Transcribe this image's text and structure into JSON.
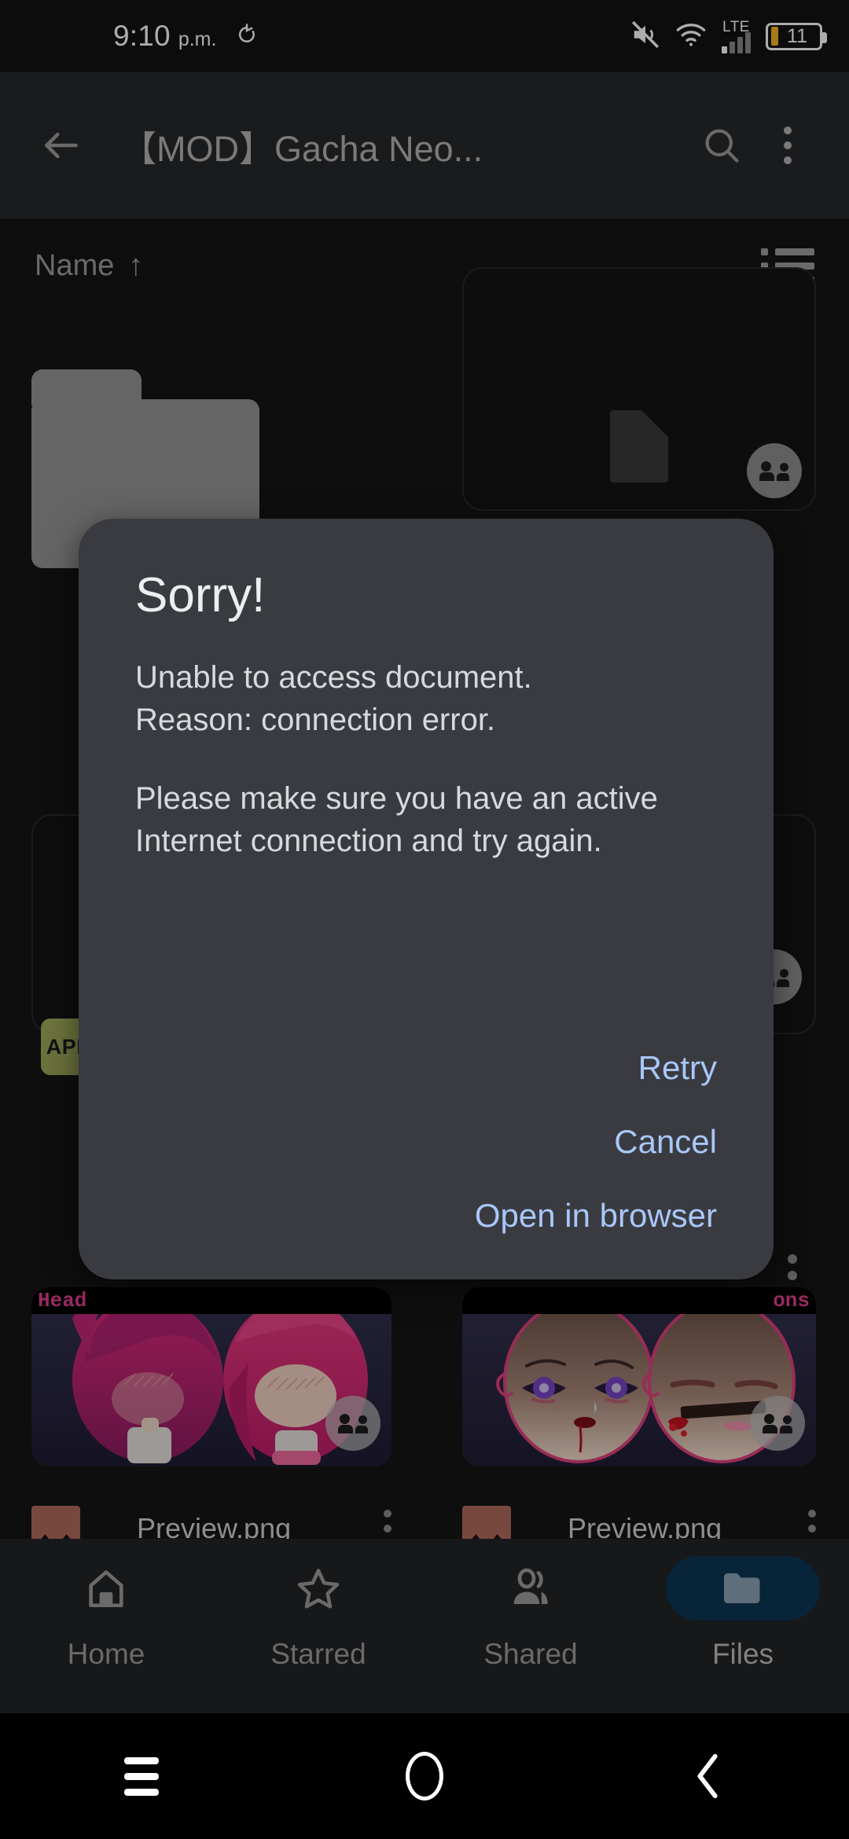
{
  "status_bar": {
    "time": "9:10",
    "ampm": "p.m.",
    "alarm_icon": "alarm-reset-icon",
    "volume_icon": "volume-muted-icon",
    "wifi_icon": "wifi-icon",
    "network_label": "LTE",
    "signal_icon": "signal-bars-icon",
    "battery_level": "11",
    "battery_color": "#f5b623"
  },
  "app_bar": {
    "back_icon": "back-arrow-icon",
    "title": "【MOD】Gacha Neo...",
    "search_icon": "search-icon",
    "overflow_icon": "overflow-menu-icon"
  },
  "sort_bar": {
    "sort_label": "Name",
    "sort_arrow": "↑",
    "view_toggle_icon": "list-view-icon"
  },
  "grid": {
    "items": [
      {
        "type": "folder",
        "name": "",
        "icon": "folder-icon"
      },
      {
        "type": "document",
        "name": "",
        "icon": "document-icon",
        "shared": true
      },
      {
        "type": "card",
        "name": "",
        "icon": "file-card-icon"
      },
      {
        "type": "apk",
        "name": "",
        "badge": "APK",
        "badge_color": "#a3ac5b"
      },
      {
        "type": "image",
        "name": "Preview.png",
        "overlay_title": "Head",
        "icon": "image-icon",
        "shared": true
      },
      {
        "type": "image",
        "name": "Preview.png",
        "overlay_title": "ons",
        "icon": "image-icon",
        "shared": true
      }
    ]
  },
  "dialog": {
    "title": "Sorry!",
    "message_line1": "Unable to access document.",
    "message_line2": "Reason: connection error.",
    "message_line3": "Please make sure you have an active",
    "message_line4": "Internet connection and try again.",
    "buttons": [
      {
        "label": "Retry",
        "name": "retry-button"
      },
      {
        "label": "Cancel",
        "name": "cancel-button"
      },
      {
        "label": "Open in browser",
        "name": "open-in-browser-button"
      }
    ],
    "accent_color": "#a8c7fa",
    "surface_color": "#3a3b40"
  },
  "bottom_nav": {
    "active_pill_color": "#0c3553",
    "items": [
      {
        "label": "Home",
        "icon": "home-icon",
        "active": false
      },
      {
        "label": "Starred",
        "icon": "star-icon",
        "active": false
      },
      {
        "label": "Shared",
        "icon": "people-icon",
        "active": false
      },
      {
        "label": "Files",
        "icon": "folder-icon",
        "active": true
      }
    ]
  },
  "system_nav": {
    "recents_icon": "recents-icon",
    "home_icon": "home-circle-icon",
    "back_icon": "back-chevron-icon"
  }
}
